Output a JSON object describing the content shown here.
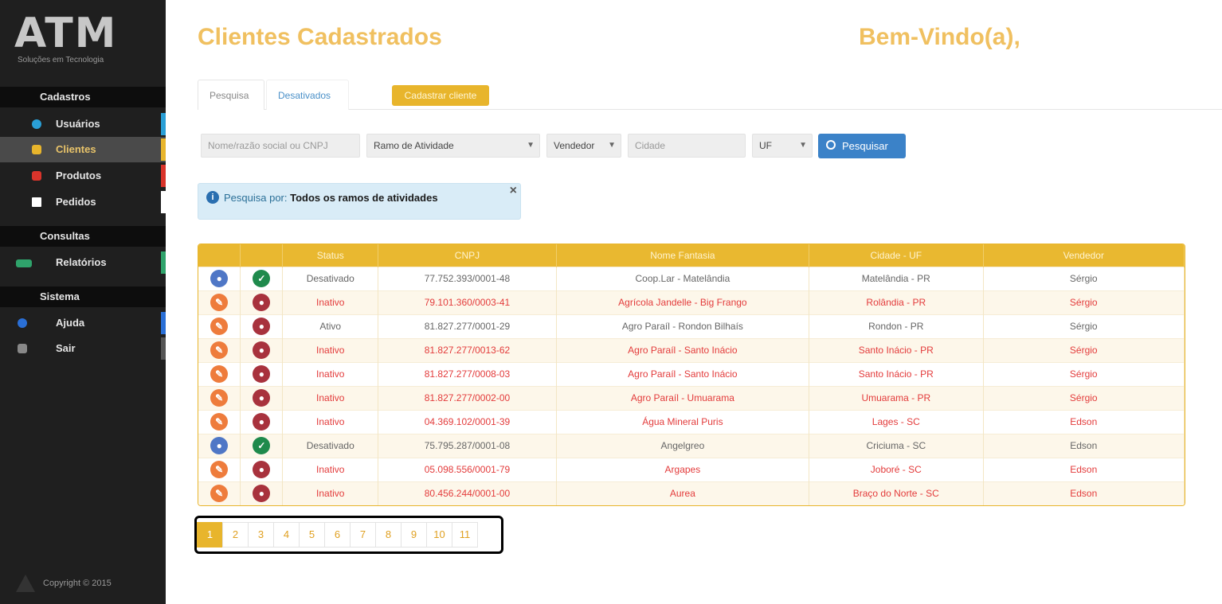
{
  "sidebar": {
    "logo": "ATM",
    "logo_sub": "Soluções em Tecnologia",
    "sections": [
      "Cadastros",
      "Consultas",
      "Sistema"
    ],
    "items": [
      {
        "label": "Usuários",
        "color": "#2a9fd6"
      },
      {
        "label": "Clientes",
        "color": "#e8b52c"
      },
      {
        "label": "Produtos",
        "color": "#d9342b"
      },
      {
        "label": "Pedidos",
        "color": "#ffffff"
      },
      {
        "label": "Relatórios",
        "color": "#2fa36b"
      },
      {
        "label": "Ajuda",
        "color": "#2a6fd6"
      },
      {
        "label": "Sair",
        "color": "#888888"
      }
    ],
    "copyright": "Copyright © 2015"
  },
  "header": {
    "title": "Clientes Cadastrados",
    "welcome": "Bem-Vindo(a),"
  },
  "tabs": {
    "search": "Pesquisa",
    "disabled": "Desativados",
    "new_client": "Cadastrar cliente"
  },
  "filters": {
    "name_placeholder": "Nome/razão social ou CNPJ",
    "activity": "Ramo de Atividade",
    "seller": "Vendedor",
    "city_placeholder": "Cidade",
    "uf": "UF",
    "search_button": "Pesquisar"
  },
  "alert": {
    "label": "Pesquisa por:",
    "value": "Todos os ramos de atividades"
  },
  "table": {
    "headers": [
      "",
      "",
      "Status",
      "CNPJ",
      "Nome Fantasia",
      "Cidade - UF",
      "Vendedor"
    ],
    "rows": [
      {
        "status": "Desativado",
        "cnpj": "77.752.393/0001-48",
        "name": "Coop.Lar - Matelândia",
        "city": "Matelândia - PR",
        "seller": "Sérgio",
        "style": "ok",
        "a": "blue",
        "b": "green"
      },
      {
        "status": "Inativo",
        "cnpj": "79.101.360/0003-41",
        "name": "Agrícola Jandelle - Big Frango",
        "city": "Rolândia - PR",
        "seller": "Sérgio",
        "style": "red",
        "a": "orange",
        "b": "maroon"
      },
      {
        "status": "Ativo",
        "cnpj": "81.827.277/0001-29",
        "name": "Agro Paraíl - Rondon Bilhaís",
        "city": "Rondon - PR",
        "seller": "Sérgio",
        "style": "ok",
        "a": "orange",
        "b": "maroon"
      },
      {
        "status": "Inativo",
        "cnpj": "81.827.277/0013-62",
        "name": "Agro Paraíl - Santo Inácio",
        "city": "Santo Inácio - PR",
        "seller": "Sérgio",
        "style": "red",
        "a": "orange",
        "b": "maroon"
      },
      {
        "status": "Inativo",
        "cnpj": "81.827.277/0008-03",
        "name": "Agro Paraíl - Santo Inácio",
        "city": "Santo Inácio - PR",
        "seller": "Sérgio",
        "style": "red",
        "a": "orange",
        "b": "maroon"
      },
      {
        "status": "Inativo",
        "cnpj": "81.827.277/0002-00",
        "name": "Agro Paraíl - Umuarama",
        "city": "Umuarama - PR",
        "seller": "Sérgio",
        "style": "red",
        "a": "orange",
        "b": "maroon"
      },
      {
        "status": "Inativo",
        "cnpj": "04.369.102/0001-39",
        "name": "Água Mineral Puris",
        "city": "Lages - SC",
        "seller": "Edson",
        "style": "red",
        "a": "orange",
        "b": "maroon"
      },
      {
        "status": "Desativado",
        "cnpj": "75.795.287/0001-08",
        "name": "Angelgreo",
        "city": "Criciuma - SC",
        "seller": "Edson",
        "style": "ok",
        "a": "blue",
        "b": "green"
      },
      {
        "status": "Inativo",
        "cnpj": "05.098.556/0001-79",
        "name": "Argapes",
        "city": "Joboré - SC",
        "seller": "Edson",
        "style": "red",
        "a": "orange",
        "b": "maroon"
      },
      {
        "status": "Inativo",
        "cnpj": "80.456.244/0001-00",
        "name": "Aurea",
        "city": "Braço do Norte - SC",
        "seller": "Edson",
        "style": "red",
        "a": "orange",
        "b": "maroon"
      }
    ]
  },
  "pagination": [
    "1",
    "2",
    "3",
    "4",
    "5",
    "6",
    "7",
    "8",
    "9",
    "10",
    "11"
  ],
  "pagination_active": "1"
}
